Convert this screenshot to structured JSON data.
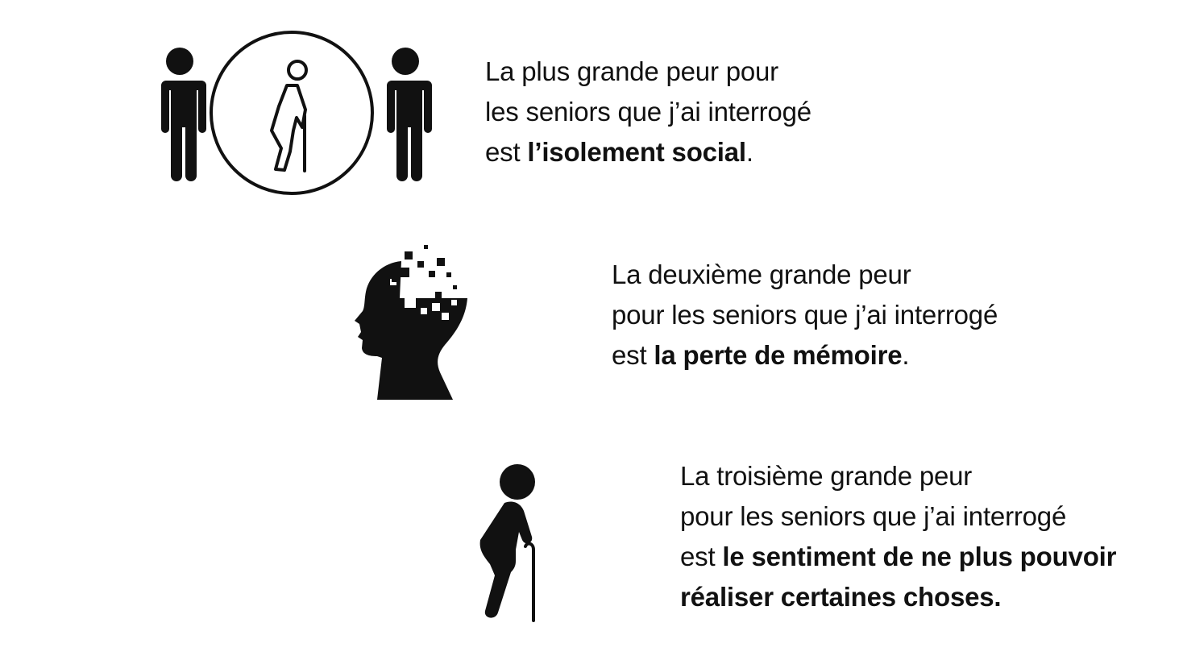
{
  "fears": [
    {
      "icon": "isolated-elder-icon",
      "line1": "La plus grande peur pour",
      "line2": "les seniors que j’ai interrogé",
      "line3_prefix": "est ",
      "line3_bold": "l’isolement social",
      "line3_suffix": "."
    },
    {
      "icon": "memory-loss-head-icon",
      "line1": "La deuxième grande peur",
      "line2": "pour les seniors que j’ai interrogé",
      "line3_prefix": "est ",
      "line3_bold": "la perte de mémoire",
      "line3_suffix": "."
    },
    {
      "icon": "elderly-walking-cane-icon",
      "line1": "La troisième grande peur",
      "line2": "pour les seniors que j’ai interrogé",
      "line3_prefix": "est ",
      "line3_bold": "le sentiment de ne plus pouvoir",
      "line4_bold": "réaliser certaines choses."
    }
  ]
}
